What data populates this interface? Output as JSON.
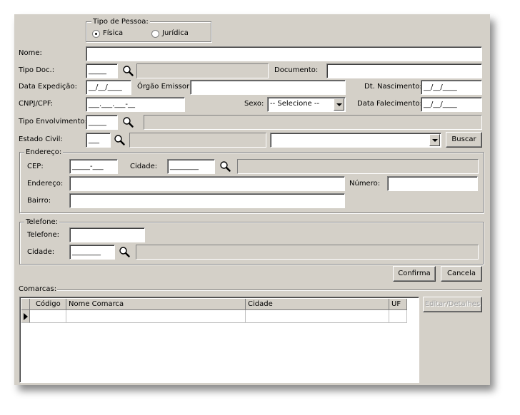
{
  "tipo_pessoa": {
    "title": "Tipo de Pessoa:",
    "fisica": "Física",
    "juridica": "Jurídica",
    "selected": "fisica"
  },
  "fields": {
    "nome": "Nome:",
    "tipo_doc": "Tipo Doc.:",
    "tipo_doc_value": "_____",
    "documento": "Documento:",
    "data_expedicao": "Data Expedição:",
    "data_expedicao_value": "__/__/____",
    "orgao_emissor": "Órgão Emissor:",
    "dt_nascimento": "Dt. Nascimento:",
    "dt_nascimento_value": "__/__/____",
    "cnpj_cpf": "CNPJ/CPF:",
    "cnpj_cpf_value": "___.___.___-__",
    "sexo": "Sexo:",
    "sexo_value": "-- Selecione --",
    "data_falecimento": "Data Falecimento:",
    "data_falecimento_value": "__/__/____",
    "tipo_envolvimento": "Tipo Envolvimento:",
    "tipo_envolvimento_value": "_____",
    "estado_civil": "Estado Civil:",
    "estado_civil_value": "___",
    "buscar": "Buscar"
  },
  "endereco": {
    "title": "Endereço:",
    "cep": "CEP:",
    "cep_value": "_____-___",
    "cidade": "Cidade:",
    "cidade_value": "________",
    "endereco": "Endereço:",
    "numero": "Número:",
    "bairro": "Bairro:"
  },
  "telefone": {
    "title": "Telefone:",
    "telefone": "Telefone:",
    "cidade": "Cidade:",
    "cidade_value": "________"
  },
  "actions": {
    "confirma": "Confirma",
    "cancela": "Cancela"
  },
  "comarcas": {
    "title": "Comarcas:",
    "columns": [
      "Código",
      "Nome Comarca",
      "Cidade",
      "UF"
    ],
    "editar": "Editar/Detalhes"
  }
}
